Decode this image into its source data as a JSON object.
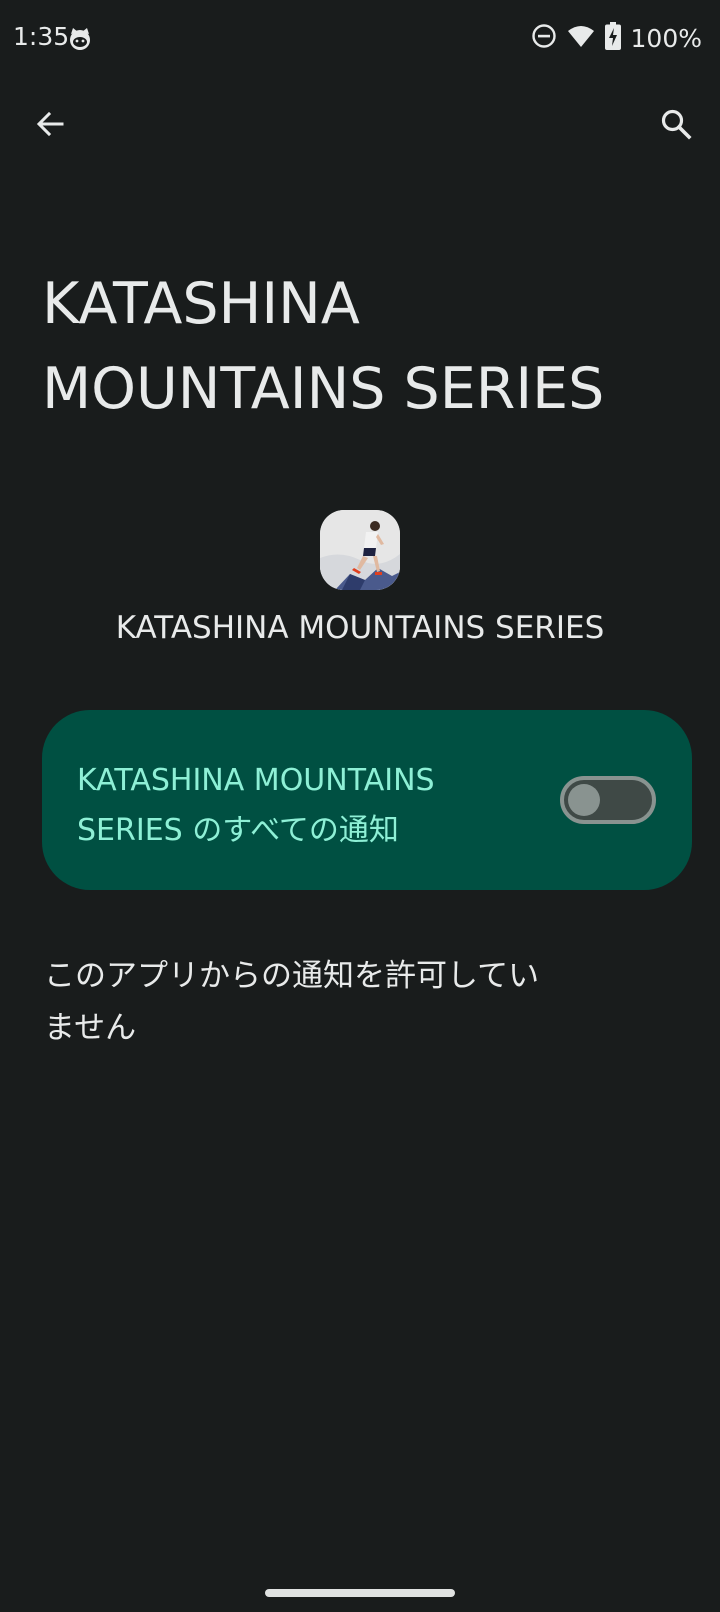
{
  "status_bar": {
    "time": "1:35",
    "battery": "100%",
    "icons": [
      "cat-notification-icon",
      "do-not-disturb-icon",
      "wifi-icon",
      "battery-charging-icon"
    ]
  },
  "top_bar": {
    "icons": [
      "back-arrow-icon",
      "search-icon"
    ]
  },
  "page": {
    "title": "KATASHINA MOUNTAINS SERIES",
    "app_name": "KATASHINA MOUNTAINS SERIES",
    "toggle_label": "KATASHINA MOUNTAINS SERIES のすべての通知",
    "toggle_on": false,
    "blocked_message": "このアプリからの通知を許可していません"
  },
  "colors": {
    "background": "#191c1c",
    "card": "#005042",
    "card_text": "#8ef0d6",
    "text": "#e8eaea"
  }
}
